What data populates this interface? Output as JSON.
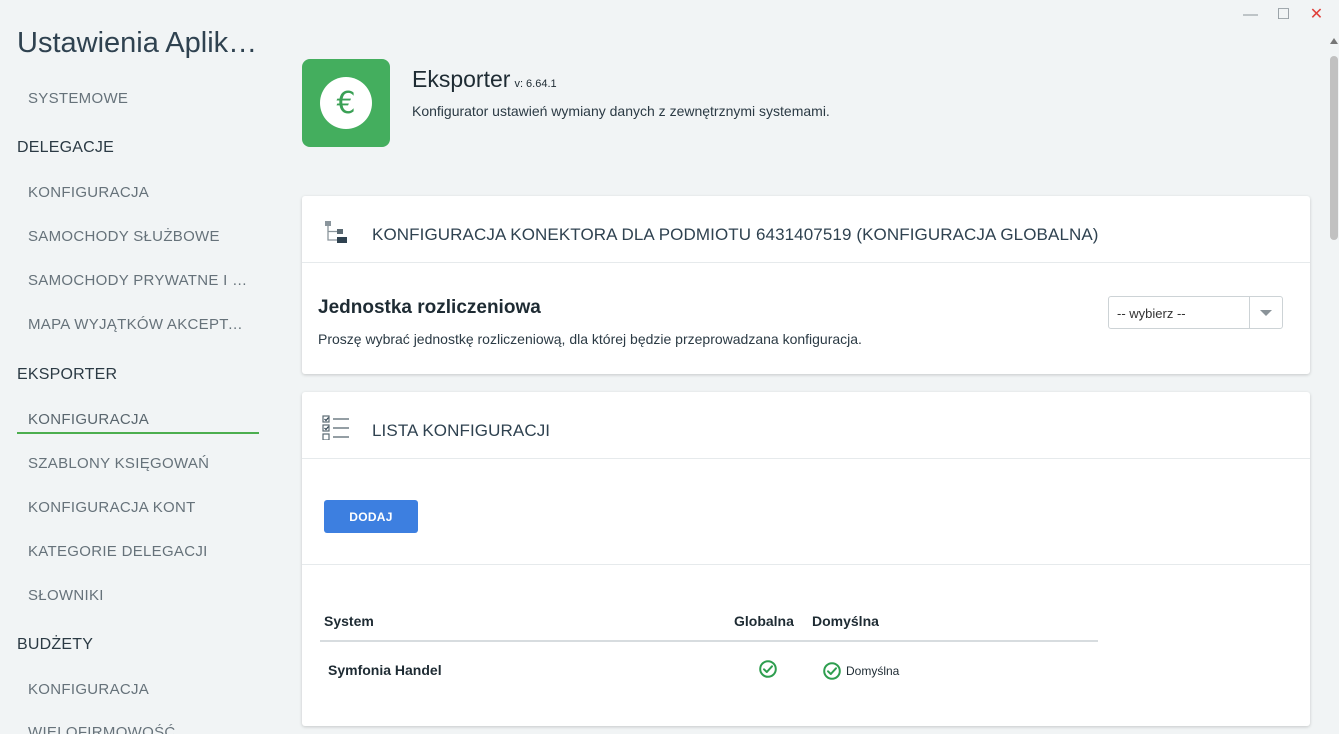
{
  "window": {
    "minimize": "—",
    "maximize": "☐",
    "close": "✕"
  },
  "sidebar": {
    "title": "Ustawienia Aplikacji",
    "items": [
      {
        "label": "SYSTEMOWE"
      },
      {
        "section": "DELEGACJE"
      },
      {
        "label": "KONFIGURACJA"
      },
      {
        "label": "SAMOCHODY SŁUŻBOWE"
      },
      {
        "label": "SAMOCHODY PRYWATNE I ŚLUŻBOWE"
      },
      {
        "label": "MAPA WYJĄTKÓW AKCEPTACJI"
      },
      {
        "section": "EKSPORTER"
      },
      {
        "label": "KONFIGURACJA",
        "active": true
      },
      {
        "label": "SZABLONY KSIĘGOWAŃ"
      },
      {
        "label": "KONFIGURACJA KONT"
      },
      {
        "label": "KATEGORIE DELEGACJI"
      },
      {
        "label": "SŁOWNIKI"
      },
      {
        "section": "BUDŻETY"
      },
      {
        "label": "KONFIGURACJA"
      },
      {
        "label": "WIELOFIRMOWOŚĆ"
      }
    ]
  },
  "header": {
    "icon": "euro-icon",
    "icon_glyph": "€",
    "app_name": "Eksporter",
    "version": "v: 6.64.1",
    "description": "Konfigurator ustawień wymiany danych z zewnętrznymi systemami.",
    "brand_color": "#44ae5e"
  },
  "connector_card": {
    "title": "KONFIGURACJA KONEKTORA DLA PODMIOTU 6431407519 (KONFIGURACJA GLOBALNA)",
    "unit_title": "Jednostka rozliczeniowa",
    "unit_desc": "Proszę wybrać jednostkę rozliczeniową, dla której będzie przeprowadzana konfiguracja.",
    "select_value": "-- wybierz --"
  },
  "list_card": {
    "title": "LISTA KONFIGURACJI",
    "add_label": "DODAJ",
    "columns": [
      "System",
      "Globalna",
      "Domyślna"
    ],
    "rows": [
      {
        "system": "Symfonia Handel",
        "global": true,
        "default": true,
        "default_label": "Domyślna"
      }
    ]
  },
  "colors": {
    "accent": "#3d7fe0",
    "success": "#2e9e4f",
    "active_underline": "#4cae4f"
  }
}
